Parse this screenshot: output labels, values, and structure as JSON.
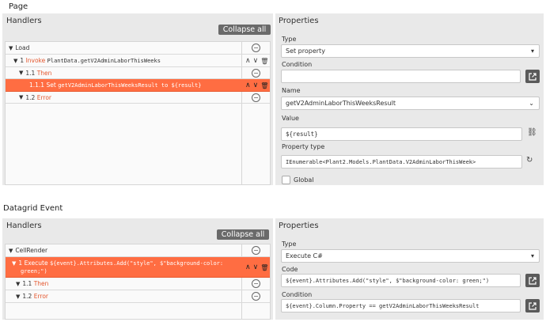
{
  "page_section": {
    "title": "Page",
    "handlers": {
      "title": "Handlers",
      "collapse_label": "Collapse all",
      "rows": [
        {
          "indent": "",
          "label": "Load"
        },
        {
          "num": "1",
          "keyword": "Invoke",
          "code": "PlantData.getV2AdminLaborThisWeeks"
        },
        {
          "num": "1.1",
          "keyword": "Then"
        },
        {
          "num": "1.1.1",
          "keyword": "Set",
          "code": "getV2AdminLaborThisWeeksResult to ${result}"
        },
        {
          "num": "1.2",
          "keyword": "Error"
        }
      ]
    },
    "properties": {
      "title": "Properties",
      "type_label": "Type",
      "type_value": "Set property",
      "condition_label": "Condition",
      "condition_value": "",
      "name_label": "Name",
      "name_value": "getV2AdminLaborThisWeeksResult",
      "value_label": "Value",
      "value_value": "${result}",
      "property_type_label": "Property type",
      "property_type_value": "IEnumerable<Plant2.Models.PlantData.V2AdminLaborThisWeek>",
      "global_label": "Global"
    }
  },
  "datagrid_section": {
    "title": "Datagrid Event",
    "handlers": {
      "title": "Handlers",
      "collapse_label": "Collapse all",
      "rows": [
        {
          "label": "CellRender"
        },
        {
          "num": "1",
          "keyword": "Execute",
          "code": "${event}.Attributes.Add(\"style\", $\"background-color:",
          "code2": "green;\")"
        },
        {
          "num": "1.1",
          "keyword": "Then"
        },
        {
          "num": "1.2",
          "keyword": "Error"
        }
      ]
    },
    "properties": {
      "title": "Properties",
      "type_label": "Type",
      "type_value": "Execute C#",
      "code_label": "Code",
      "code_value": "${event}.Attributes.Add(\"style\", $\"background-color: green;\")",
      "condition_label": "Condition",
      "condition_value": "${event}.Column.Property == getV2AdminLaborThisWeeksResult"
    }
  },
  "colors": {
    "accent": "#ff6d42",
    "keyword": "#e4572e",
    "panel": "#e9e9e9"
  }
}
